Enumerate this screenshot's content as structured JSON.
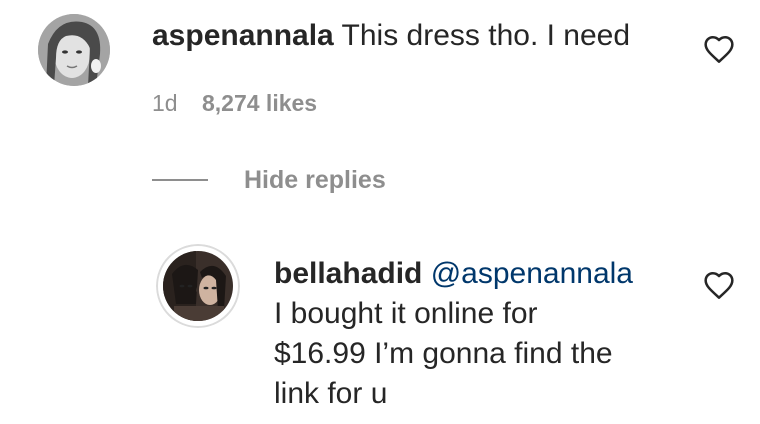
{
  "comment": {
    "username": "aspenannala",
    "text": "This dress tho. I need",
    "time": "1d",
    "likes": "8,274 likes",
    "avatar_icon": "user-avatar-photo",
    "like_icon": "heart-outline-icon"
  },
  "replies_toggle": {
    "label": "Hide replies"
  },
  "reply": {
    "username": "bellahadid",
    "mention": "@aspenannala",
    "text_lines": [
      "I bought it online for",
      "$16.99 I’m gonna find the",
      "link for u"
    ],
    "avatar_icon": "user-avatar-photo",
    "like_icon": "heart-outline-icon"
  },
  "colors": {
    "text": "#262626",
    "secondary": "#8e8e8e",
    "mention": "#00376b",
    "background": "#ffffff"
  }
}
